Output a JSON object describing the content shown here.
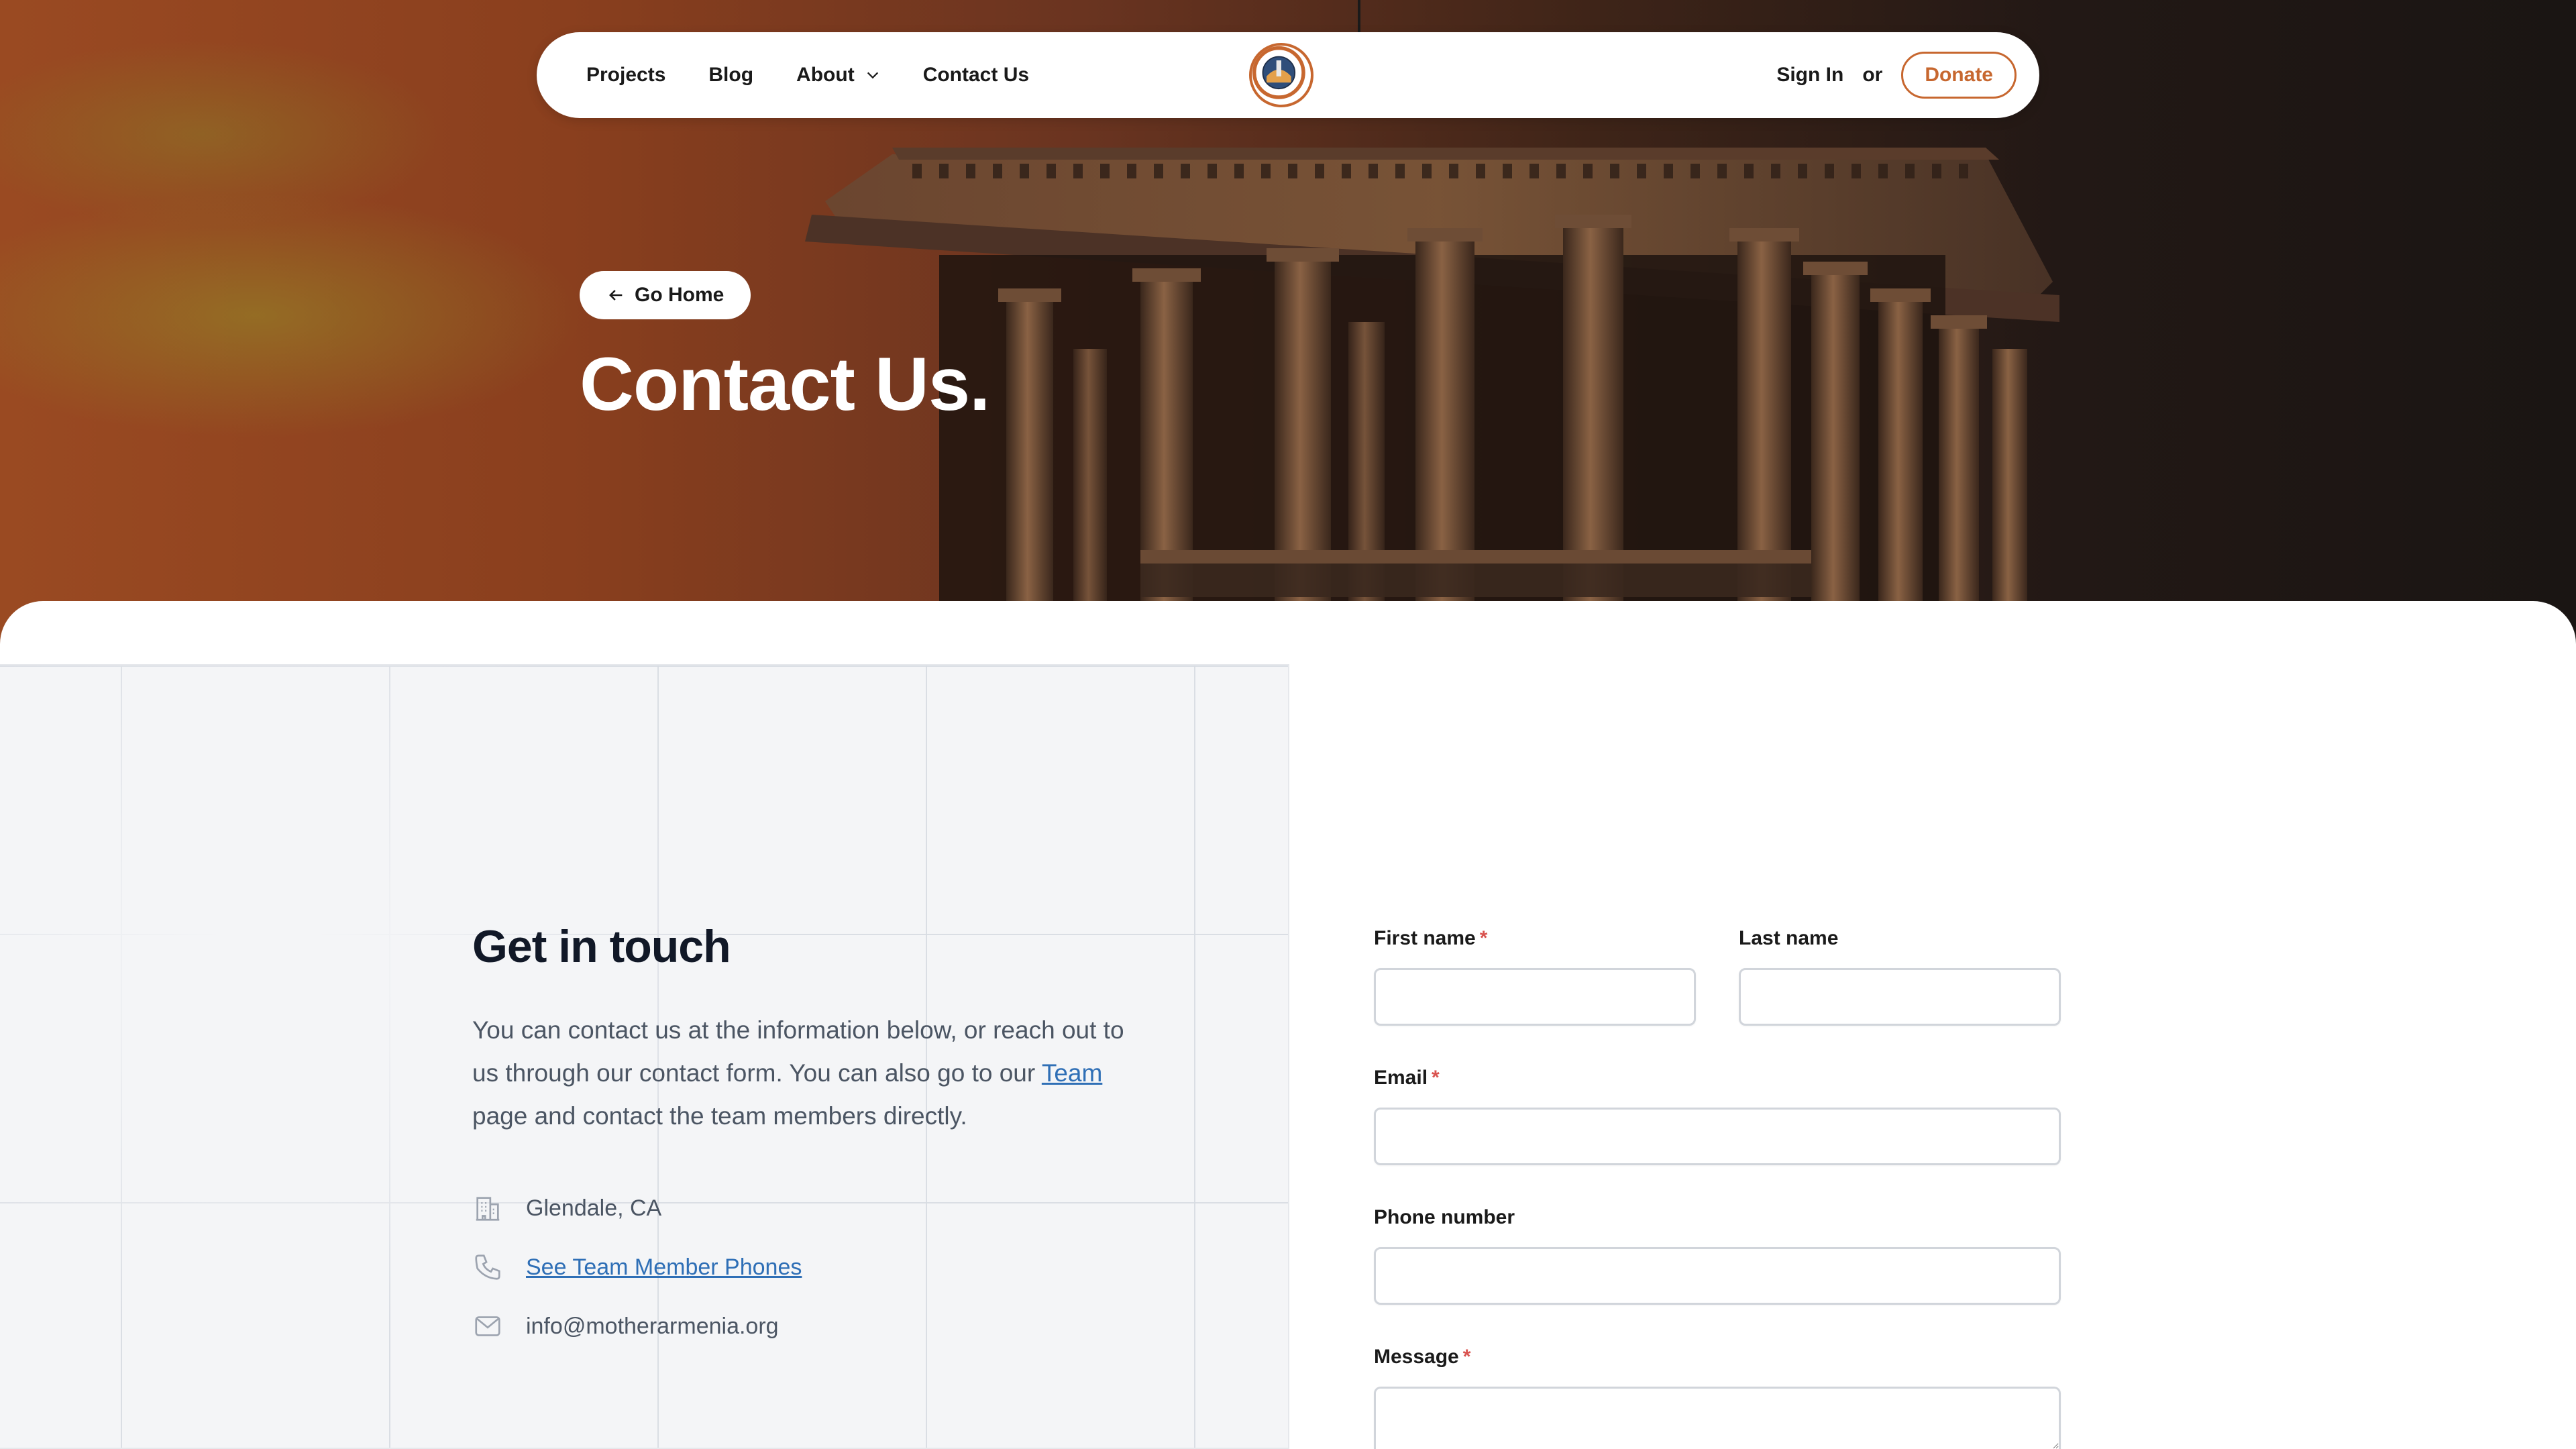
{
  "nav": {
    "links": [
      {
        "label": "Projects"
      },
      {
        "label": "Blog"
      },
      {
        "label": "About"
      },
      {
        "label": "Contact Us"
      }
    ],
    "signin": "Sign In",
    "or": "or",
    "donate": "Donate"
  },
  "hero": {
    "go_home": "Go Home",
    "title": "Contact Us."
  },
  "contact": {
    "title": "Get in touch",
    "desc_before": "You can contact us at the information below, or reach out to us through our contact form. You can also go to our ",
    "team_link": "Team",
    "desc_after": " page and contact the team members directly.",
    "location": "Glendale, CA",
    "phones_link": "See Team Member Phones",
    "email": "info@motherarmenia.org"
  },
  "form": {
    "first_name": {
      "label": "First name",
      "required": "*",
      "value": ""
    },
    "last_name": {
      "label": "Last name",
      "value": ""
    },
    "email": {
      "label": "Email",
      "required": "*",
      "value": ""
    },
    "phone": {
      "label": "Phone number",
      "value": ""
    },
    "message": {
      "label": "Message",
      "required": "*",
      "value": ""
    }
  },
  "colors": {
    "accent": "#c7672f",
    "link": "#2f6fb6",
    "required": "#d9534f"
  }
}
